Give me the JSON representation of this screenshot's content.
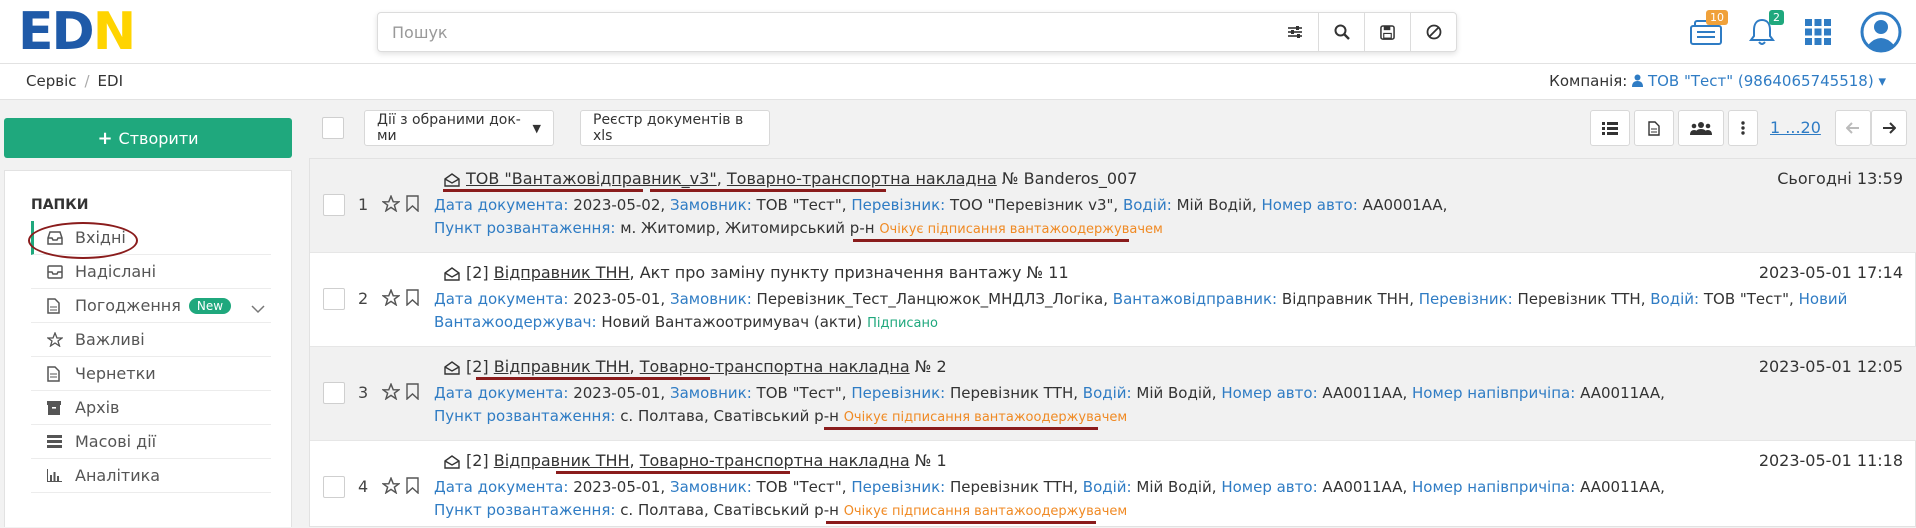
{
  "header": {
    "logo": {
      "e": "E",
      "d": "D",
      "n": "N"
    },
    "search_placeholder": "Пошук",
    "inbox_badge": "10",
    "bell_badge": "2"
  },
  "breadcrumb": {
    "item1": "Сервіс",
    "sep": "/",
    "item2": "EDI"
  },
  "company": {
    "label": "Компанія:",
    "value": "ТОВ \"Тест\" (9864065745518)"
  },
  "sidebar": {
    "create_label": "Створити",
    "folders_title": "ПАПКИ",
    "items": [
      {
        "label": "Вхідні"
      },
      {
        "label": "Надіслані"
      },
      {
        "label": "Погодження",
        "pill": "New"
      },
      {
        "label": "Важливі"
      },
      {
        "label": "Чернетки"
      },
      {
        "label": "Архів"
      },
      {
        "label": "Масові дії"
      },
      {
        "label": "Аналітика"
      }
    ]
  },
  "toolbar": {
    "bulk_actions": "Дії з обраними док-ми",
    "export_xls": "Реєстр документів в xls",
    "pager": "1 ...20"
  },
  "documents": [
    {
      "num": "1",
      "sender": "ТОВ \"Вантажовідправник_v3\"",
      "sep": ",",
      "doc_type": "Товарно-транспортна накладна",
      "doc_no": "№ Banderos_007",
      "date": "Сьогодні 13:59",
      "line1": [
        {
          "k": "Дата документа:",
          "v": "2023-05-02,"
        },
        {
          "k": "Замовник:",
          "v": "ТОВ \"Тест\","
        },
        {
          "k": "Перевізник:",
          "v": "ТОО \"Перевізник v3\","
        },
        {
          "k": "Водій:",
          "v": "Мій Водій,"
        },
        {
          "k": "Номер авто:",
          "v": "AA0001AA,"
        }
      ],
      "line2_label": "Пункт розвантаження:",
      "line2_value": "м. Житомир, Житомирський р-н",
      "status": "Очікує підписання вантажоодержувачем"
    },
    {
      "num": "2",
      "sender_prefix": "[2]",
      "sender": "Відправник ТНН",
      "sep": ",",
      "doc_type": "Акт про заміну пункту призначення вантажу",
      "doc_no": "№ 11",
      "date": "2023-05-01 17:14",
      "line1": [
        {
          "k": "Дата документа:",
          "v": "2023-05-01,"
        },
        {
          "k": "Замовник:",
          "v": "Перевізник_Тест_Ланцюжок_МНДЛЗ_Логіка,"
        },
        {
          "k": "Вантажовідправник:",
          "v": "Відправник ТНН,"
        },
        {
          "k": "Перевізник:",
          "v": "Перевізник ТТН,"
        },
        {
          "k": "Водій:",
          "v": "ТОВ \"Тест\","
        },
        {
          "k": "Новий",
          "v": ""
        }
      ],
      "line2_label": "Вантажоодержувач:",
      "line2_value": "Новий Вантажоотримувач (акти)",
      "status": "Підписано"
    },
    {
      "num": "3",
      "sender_prefix": "[2]",
      "sender": "Відправник ТНН",
      "sep": ",",
      "doc_type": "Товарно-транспортна накладна",
      "doc_no": "№ 2",
      "date": "2023-05-01 12:05",
      "line1": [
        {
          "k": "Дата документа:",
          "v": "2023-05-01,"
        },
        {
          "k": "Замовник:",
          "v": "ТОВ \"Тест\","
        },
        {
          "k": "Перевізник:",
          "v": "Перевізник ТТН,"
        },
        {
          "k": "Водій:",
          "v": "Мій Водій,"
        },
        {
          "k": "Номер авто:",
          "v": "AA0011AA,"
        },
        {
          "k": "Номер напівпричіпа:",
          "v": "AA0011AA,"
        }
      ],
      "line2_label": "Пункт розвантаження:",
      "line2_value": "с. Полтава, Сватівський р-н",
      "status": "Очікує підписання вантажоодержувачем"
    },
    {
      "num": "4",
      "sender_prefix": "[2]",
      "sender": "Відправник ТНН",
      "sep": ",",
      "doc_type": "Товарно-транспортна накладна",
      "doc_no": "№ 1",
      "date": "2023-05-01 11:18",
      "line1": [
        {
          "k": "Дата документа:",
          "v": "2023-05-01,"
        },
        {
          "k": "Замовник:",
          "v": "ТОВ \"Тест\","
        },
        {
          "k": "Перевізник:",
          "v": "Перевізник ТТН,"
        },
        {
          "k": "Водій:",
          "v": "Мій Водій,"
        },
        {
          "k": "Номер авто:",
          "v": "AA0011AA,"
        },
        {
          "k": "Номер напівпричіпа:",
          "v": "AA0011AA,"
        }
      ],
      "line2_label": "Пункт розвантаження:",
      "line2_value": "с. Полтава, Сватівський р-н",
      "status": "Очікує підписання вантажоодержувачем"
    }
  ]
}
